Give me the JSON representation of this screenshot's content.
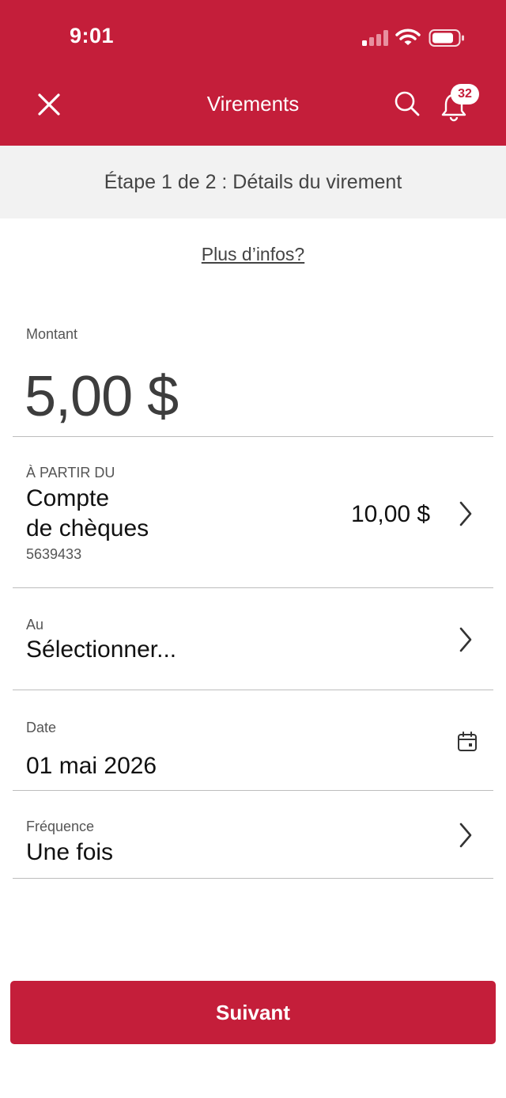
{
  "status_bar": {
    "time": "9:01",
    "icons": [
      "signal-icon",
      "wifi-icon",
      "battery-icon"
    ]
  },
  "header": {
    "title": "Virements",
    "close_icon": "close-icon",
    "search_icon": "search-icon",
    "bell_icon": "bell-icon",
    "notification_count": "32"
  },
  "step": {
    "text": "Étape 1 de 2 : Détails du virement"
  },
  "more_info": {
    "link": "Plus d’infos?"
  },
  "form": {
    "amount": {
      "label": "Montant",
      "value": "5,00 $"
    },
    "from": {
      "label": "À PARTIR DU",
      "account_line1": "Compte",
      "account_line2": "de chèques",
      "account_number": "5639433",
      "balance": "10,00 $"
    },
    "to": {
      "label": "Au",
      "value": "Sélectionner..."
    },
    "date": {
      "label": "Date",
      "value": "01 mai 2026",
      "icon": "calendar-icon"
    },
    "frequency": {
      "label": "Fréquence",
      "value": "Une fois"
    }
  },
  "actions": {
    "next_label": "Suivant"
  },
  "colors": {
    "brand": "#c41e3a",
    "step_bg": "#f2f2f2",
    "divider": "#bdbdbd"
  }
}
